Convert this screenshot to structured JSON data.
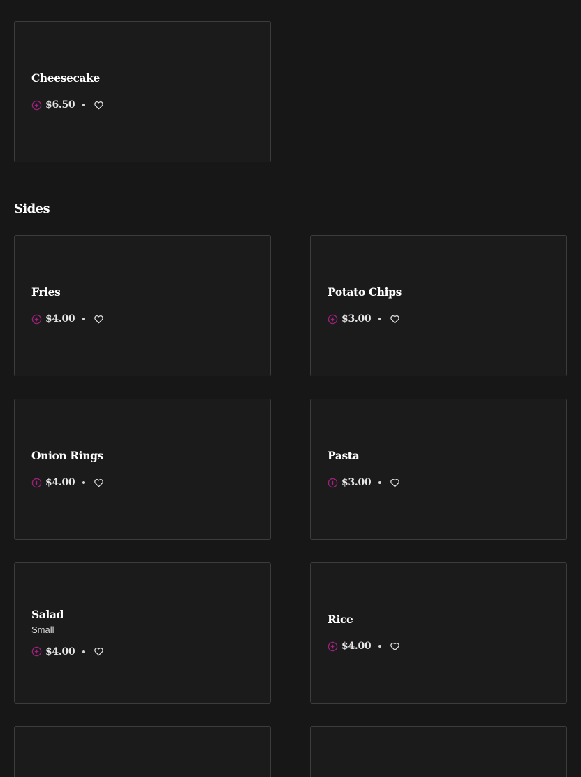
{
  "colors": {
    "background": "#171717",
    "card_background": "#1b1b1c",
    "card_border": "#3c3c3c",
    "accent": "#a0207a",
    "text": "#ffffff"
  },
  "icons": {
    "add": "plus-circle-icon",
    "favorite": "heart-outline-icon"
  },
  "dessert_items": [
    {
      "name": "Cheesecake",
      "price": "$6.50"
    }
  ],
  "sides": {
    "title": "Sides",
    "items": [
      {
        "name": "Fries",
        "price": "$4.00"
      },
      {
        "name": "Potato Chips",
        "price": "$3.00"
      },
      {
        "name": "Onion Rings",
        "price": "$4.00"
      },
      {
        "name": "Pasta",
        "price": "$3.00"
      },
      {
        "name": "Salad",
        "description": "Small",
        "price": "$4.00"
      },
      {
        "name": "Rice",
        "price": "$4.00"
      }
    ]
  }
}
